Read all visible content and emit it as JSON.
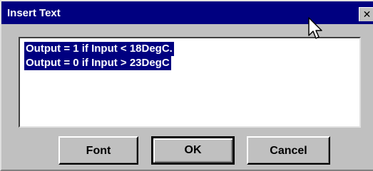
{
  "dialog": {
    "title": "Insert Text",
    "close_glyph": "✕"
  },
  "text": {
    "lines": [
      "Output = 1 if Input < 18DegC.",
      "Output = 0 if Input > 23DegC"
    ]
  },
  "buttons": {
    "font": "Font",
    "ok": "OK",
    "cancel": "Cancel"
  },
  "colors": {
    "titlebar": "#000080",
    "selection": "#000080",
    "face": "#c0c0c0"
  },
  "icons": {
    "pointer": "mouse-pointer-icon",
    "close": "close-icon"
  }
}
